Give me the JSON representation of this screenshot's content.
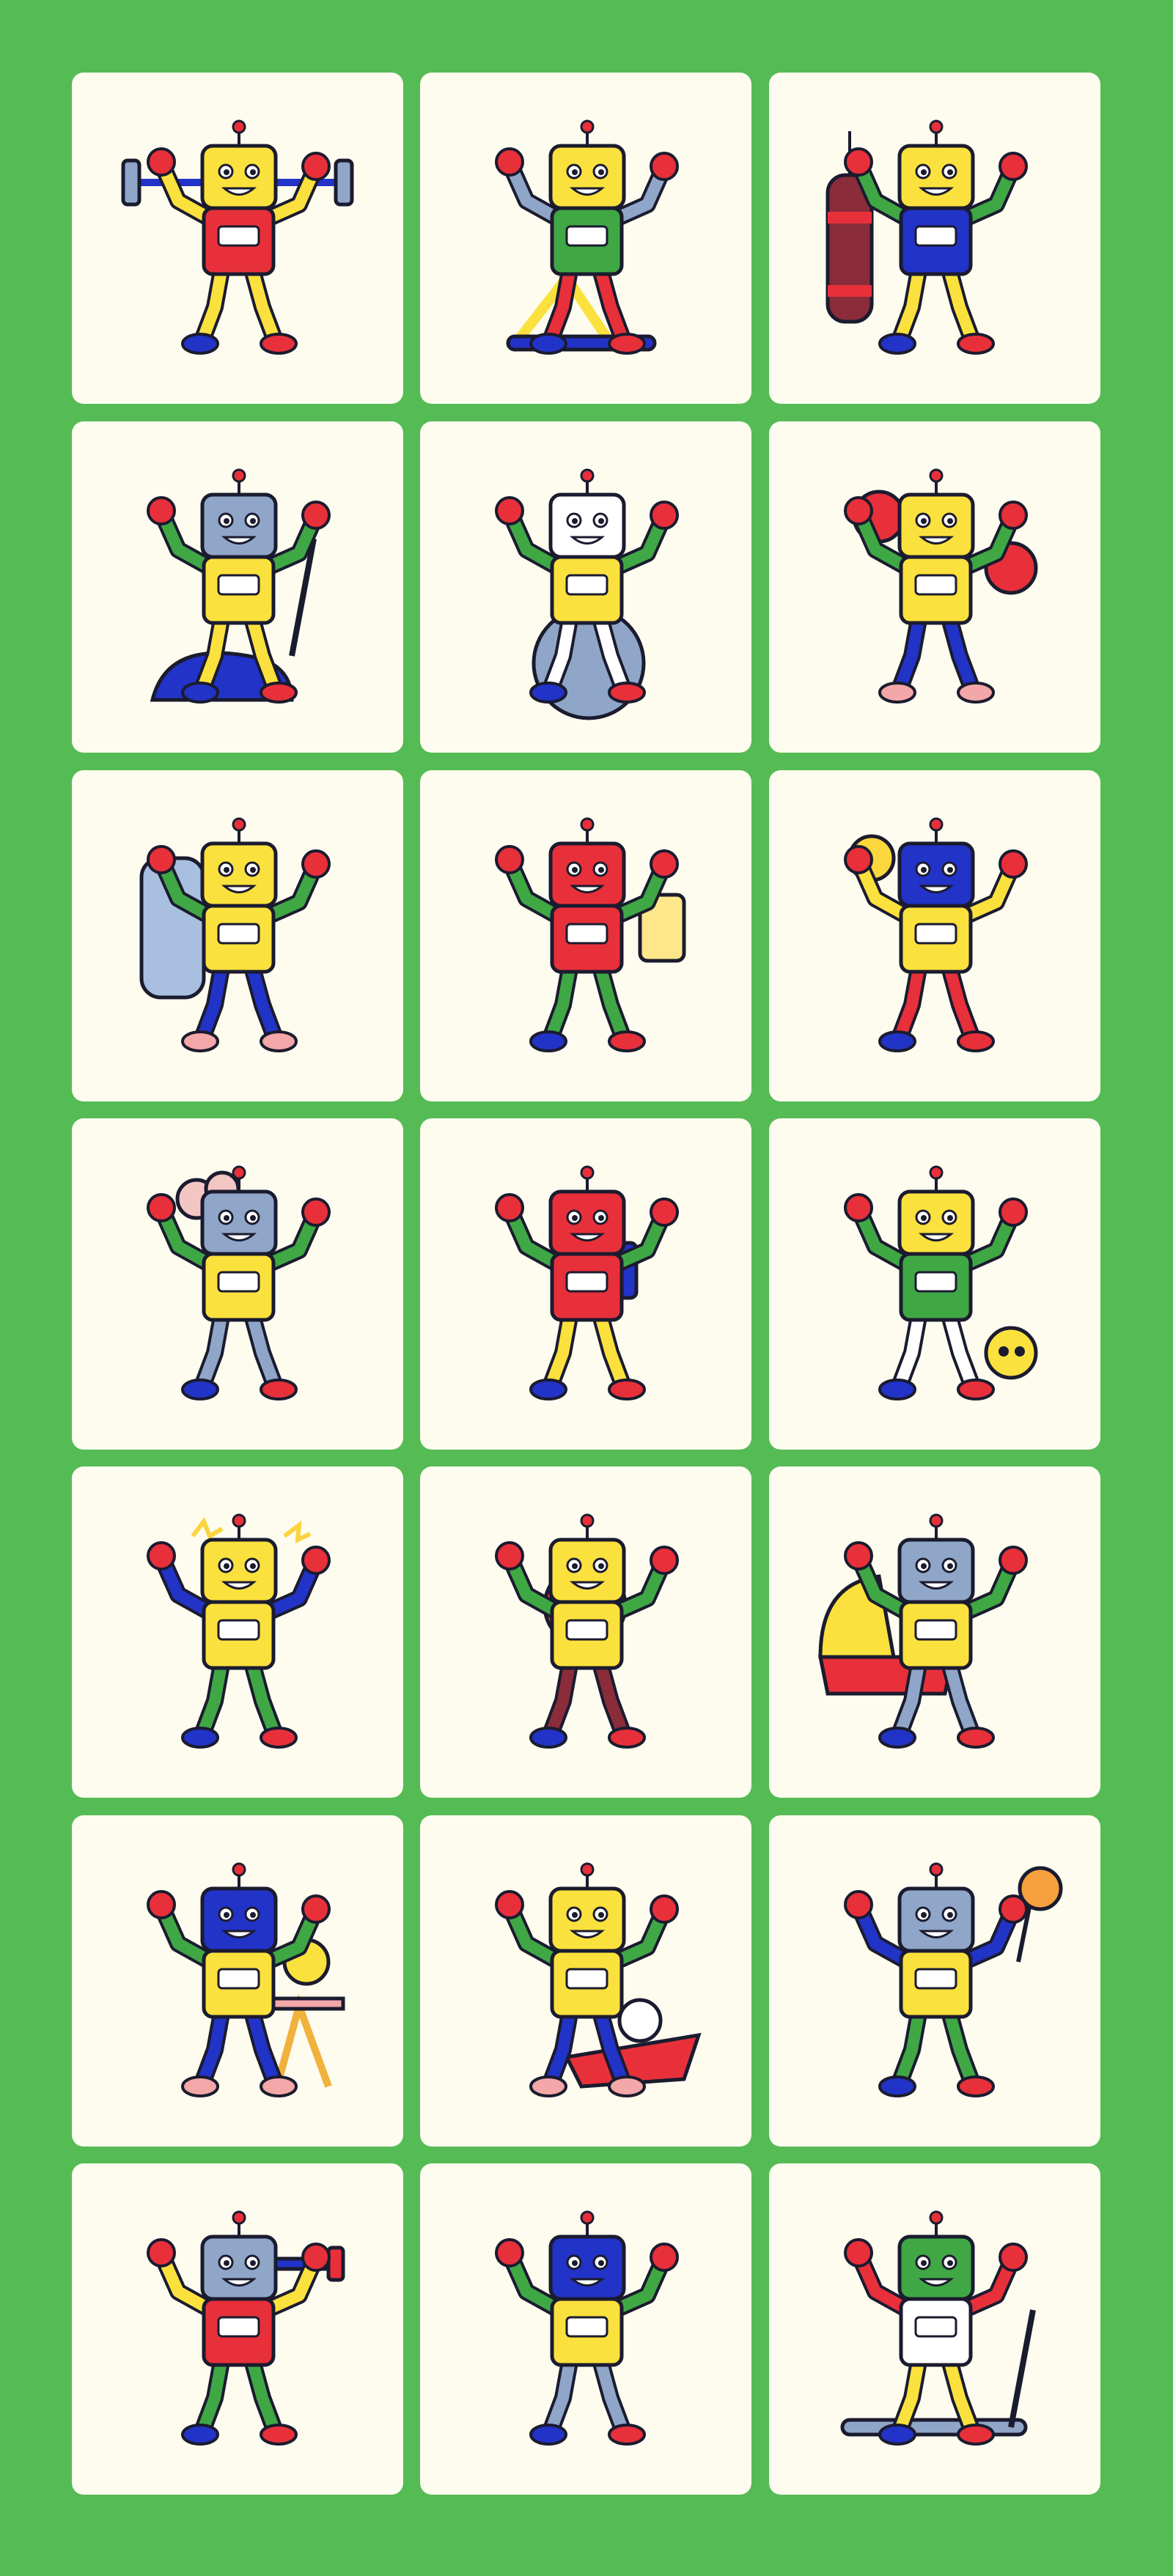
{
  "page": {
    "background": "#55bb55",
    "card_background": "#fdfcef"
  },
  "palette": {
    "outline": "#1b1b2f",
    "red": "#e8303a",
    "yellow": "#fbe13d",
    "blue": "#2233c8",
    "green": "#3fa845",
    "pink": "#f4a7a8",
    "grey": "#8fa6c8",
    "maroon": "#8a2c3a",
    "white": "#ffffff"
  },
  "illustrations": [
    {
      "icon": "robot-weightlifting-barbell-icon",
      "head": "yellow",
      "body": "red",
      "arms": "yellow",
      "legs": "yellow",
      "prop": "barbell"
    },
    {
      "icon": "robot-elliptical-trainer-icon",
      "head": "yellow",
      "body": "green",
      "arms": "grey",
      "legs": "red",
      "prop": "elliptical"
    },
    {
      "icon": "robot-punching-bag-icon",
      "head": "yellow",
      "body": "blue",
      "arms": "green",
      "legs": "yellow",
      "prop": "punching-bag"
    },
    {
      "icon": "robot-exercise-bike-icon",
      "head": "grey",
      "body": "yellow",
      "arms": "green",
      "legs": "yellow",
      "prop": "exercise-bike"
    },
    {
      "icon": "robot-yoga-ball-icon",
      "head": "white",
      "body": "yellow",
      "arms": "green",
      "legs": "white",
      "prop": "yoga-ball"
    },
    {
      "icon": "robot-boxing-gloves-icon",
      "head": "yellow",
      "body": "yellow",
      "arms": "green",
      "legs": "blue",
      "prop": "boxing-gloves"
    },
    {
      "icon": "robot-water-bottle-icon",
      "head": "yellow",
      "body": "yellow",
      "arms": "green",
      "legs": "blue",
      "prop": "water-bottle"
    },
    {
      "icon": "robot-juice-thumbs-up-icon",
      "head": "red",
      "body": "red",
      "arms": "green",
      "legs": "green",
      "prop": "juice"
    },
    {
      "icon": "robot-lightbulb-idea-icon",
      "head": "blue",
      "body": "yellow",
      "arms": "yellow",
      "legs": "red",
      "prop": "lightbulb"
    },
    {
      "icon": "robot-overheated-icon",
      "head": "grey",
      "body": "yellow",
      "arms": "green",
      "legs": "grey",
      "prop": "steam"
    },
    {
      "icon": "robot-stock-chart-icon",
      "head": "red",
      "body": "red",
      "arms": "green",
      "legs": "yellow",
      "prop": "chart"
    },
    {
      "icon": "robot-parent-with-child-icon",
      "head": "yellow",
      "body": "green",
      "arms": "green",
      "legs": "white",
      "prop": "small-robot"
    },
    {
      "icon": "robot-stressed-icon",
      "head": "yellow",
      "body": "yellow",
      "arms": "blue",
      "legs": "green",
      "prop": "alert"
    },
    {
      "icon": "robot-alarm-clock-icon",
      "head": "yellow",
      "body": "yellow",
      "arms": "green",
      "legs": "maroon",
      "prop": "clock"
    },
    {
      "icon": "robot-baby-cradle-icon",
      "head": "grey",
      "body": "yellow",
      "arms": "green",
      "legs": "grey",
      "prop": "cradle"
    },
    {
      "icon": "robot-feeding-baby-icon",
      "head": "blue",
      "body": "yellow",
      "arms": "green",
      "legs": "blue",
      "prop": "high-chair"
    },
    {
      "icon": "robot-baby-bouncer-icon",
      "head": "yellow",
      "body": "yellow",
      "arms": "green",
      "legs": "blue",
      "prop": "bouncer"
    },
    {
      "icon": "robot-baby-rattle-icon",
      "head": "grey",
      "body": "yellow",
      "arms": "blue",
      "legs": "green",
      "prop": "rattle"
    },
    {
      "icon": "robot-dumbbell-icon",
      "head": "grey",
      "body": "red",
      "arms": "yellow",
      "legs": "green",
      "prop": "dumbbell"
    },
    {
      "icon": "robot-flexing-icon",
      "head": "blue",
      "body": "yellow",
      "arms": "green",
      "legs": "grey",
      "prop": "none"
    },
    {
      "icon": "robot-treadmill-icon",
      "head": "green",
      "body": "white",
      "arms": "red",
      "legs": "yellow",
      "prop": "treadmill"
    }
  ]
}
